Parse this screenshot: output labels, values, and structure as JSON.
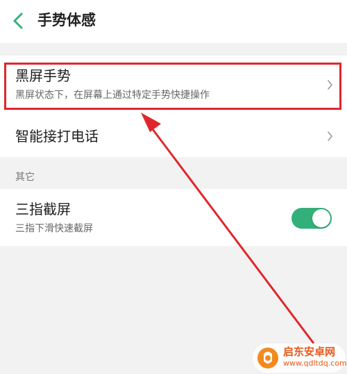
{
  "header": {
    "title": "手势体感"
  },
  "gestures": [
    {
      "title": "黑屏手势",
      "subtitle": "黑屏状态下，在屏幕上通过特定手势快捷操作"
    },
    {
      "title": "智能接打电话"
    }
  ],
  "other": {
    "label": "其它",
    "three_finger": {
      "title": "三指截屏",
      "subtitle": "三指下滑快速截屏",
      "enabled": true
    }
  },
  "watermark": {
    "name": "启东安卓网",
    "url": "www.qdltdq.com"
  },
  "colors": {
    "accent": "#33b07a",
    "annotation": "#e0262b",
    "watermark": "#e85a1c"
  }
}
